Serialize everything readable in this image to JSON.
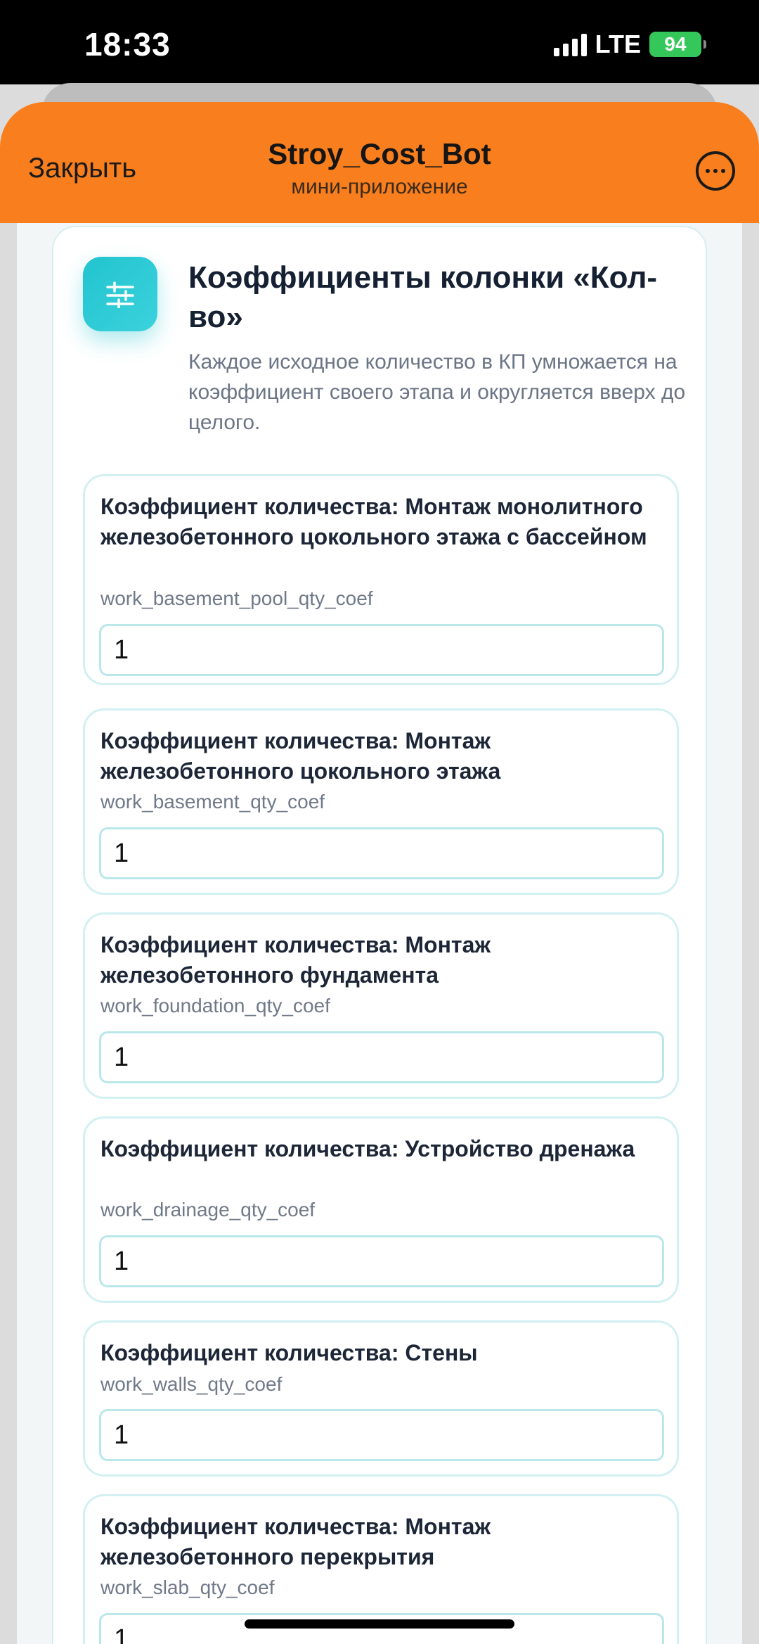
{
  "status_bar": {
    "time": "18:33",
    "network": "LTE",
    "battery": "94"
  },
  "header": {
    "close_label": "Закрыть",
    "title": "Stroy_Cost_Bot",
    "subtitle": "мини-приложение"
  },
  "section": {
    "icon": "sliders-icon",
    "title": "Коэффициенты колонки «Кол-во»",
    "description": "Каждое исходное количество в КП умножается на коэффициент своего этапа и округляется вверх до целого."
  },
  "fields": [
    {
      "label": "Коэффициент количества: Монтаж монолитного железобетонного цокольного этажа с бассейном",
      "key": "work_basement_pool_qty_coef",
      "value": "1"
    },
    {
      "label": "Коэффициент количества: Монтаж железобетонного цокольного этажа",
      "key": "work_basement_qty_coef",
      "value": "1"
    },
    {
      "label": "Коэффициент количества: Монтаж железобетонного фундамента",
      "key": "work_foundation_qty_coef",
      "value": "1"
    },
    {
      "label": "Коэффициент количества: Устройство дренажа",
      "key": "work_drainage_qty_coef",
      "value": "1"
    },
    {
      "label": "Коэффициент количества: Стены",
      "key": "work_walls_qty_coef",
      "value": "1"
    },
    {
      "label": "Коэффициент количества: Монтаж железобетонного перекрытия",
      "key": "work_slab_qty_coef",
      "value": "1"
    }
  ],
  "colors": {
    "header": "#f97f1e",
    "accent": "#22c4cf",
    "battery": "#34c759"
  }
}
